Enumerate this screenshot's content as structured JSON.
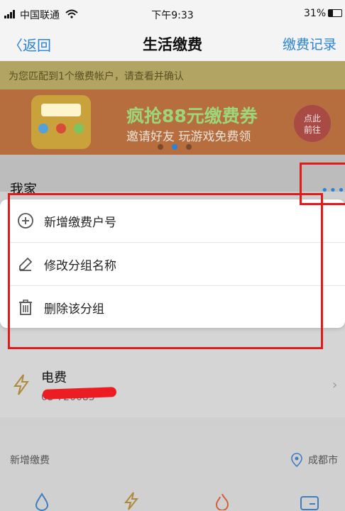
{
  "status_bar": {
    "carrier": "中国联通",
    "time": "下午9:33",
    "battery": "31%"
  },
  "nav": {
    "back_label": "返回",
    "title": "生活缴费",
    "right_label": "缴费记录"
  },
  "notice": "为您匹配到1个缴费帐户，请查看并确认",
  "banner": {
    "title": "疯抢88元缴费券",
    "subtitle": "邀请好友 玩游戏免费领",
    "cta_line1": "点此",
    "cta_line2": "前往"
  },
  "group": {
    "title": "我家",
    "more_icon": "ellipsis-icon"
  },
  "menu": {
    "items": [
      {
        "label": "新增缴费户号",
        "icon": "plus-circle-icon"
      },
      {
        "label": "修改分组名称",
        "icon": "edit-icon"
      },
      {
        "label": "删除该分组",
        "icon": "trash-icon"
      }
    ]
  },
  "bill": {
    "title": "电费",
    "account": "03 720085"
  },
  "footer": {
    "left": "新增缴费",
    "right": "成都市"
  },
  "colors": {
    "accent": "#2a83d6",
    "annotation": "#e21a1a"
  }
}
